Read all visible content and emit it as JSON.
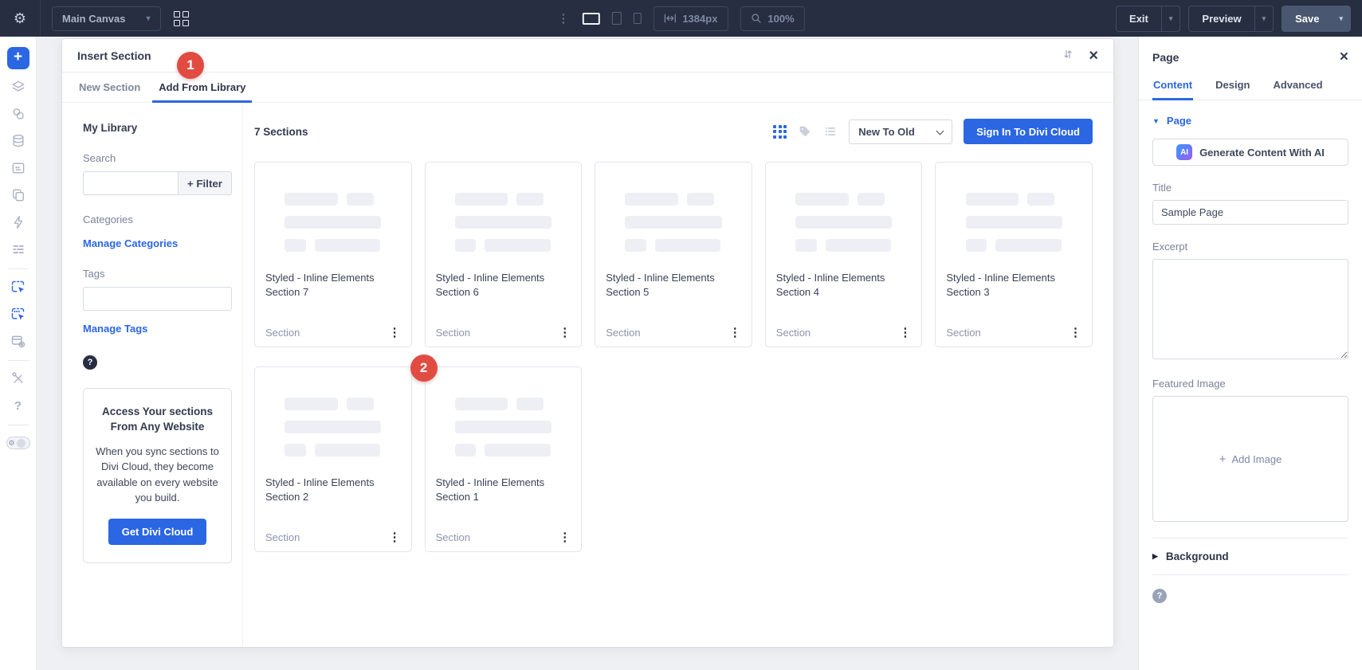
{
  "colors": {
    "accent": "#2b66e3",
    "badge_red": "#e14b42",
    "topbar_bg": "#272e42"
  },
  "icons": {
    "gear": "⚙",
    "kebab_vertical": "⋮",
    "close": "×",
    "chevron_down": "▾",
    "caret_down_filled": "▼",
    "caret_right_filled": "▶",
    "plus": "+",
    "question": "?"
  },
  "topbar": {
    "canvas_selector": "Main Canvas",
    "width_value": "1384px",
    "zoom_value": "100%",
    "exit_label": "Exit",
    "preview_label": "Preview",
    "save_label": "Save"
  },
  "badges": {
    "one": "1",
    "two": "2"
  },
  "modal": {
    "title": "Insert Section",
    "tabs": [
      {
        "label": "New Section",
        "active": false
      },
      {
        "label": "Add From Library",
        "active": true
      }
    ],
    "library": {
      "heading": "My Library",
      "search_label": "Search",
      "filter_button": "+ Filter",
      "categories_label": "Categories",
      "manage_categories_link": "Manage Categories",
      "tags_label": "Tags",
      "manage_tags_link": "Manage Tags",
      "help": "?",
      "promo": {
        "heading": "Access Your sections From Any Website",
        "body": "When you sync sections to Divi Cloud, they become available on every website you build.",
        "button": "Get Divi Cloud"
      }
    },
    "toolbar": {
      "count": "7 Sections",
      "sort_value": "New To Old",
      "signin_button": "Sign In To Divi Cloud"
    },
    "cards": [
      {
        "title": "Styled - Inline Elements Section 7",
        "type": "Section"
      },
      {
        "title": "Styled - Inline Elements Section 6",
        "type": "Section"
      },
      {
        "title": "Styled - Inline Elements Section 5",
        "type": "Section"
      },
      {
        "title": "Styled - Inline Elements Section 4",
        "type": "Section"
      },
      {
        "title": "Styled - Inline Elements Section 3",
        "type": "Section"
      },
      {
        "title": "Styled - Inline Elements Section 2",
        "type": "Section"
      },
      {
        "title": "Styled - Inline Elements Section 1",
        "type": "Section"
      }
    ]
  },
  "settings_panel": {
    "title": "Page",
    "tabs": [
      {
        "label": "Content",
        "active": true
      },
      {
        "label": "Design",
        "active": false
      },
      {
        "label": "Advanced",
        "active": false
      }
    ],
    "page_accordion": "Page",
    "ai_button": "Generate Content With AI",
    "ai_chip": "AI",
    "title_label": "Title",
    "title_value": "Sample Page",
    "excerpt_label": "Excerpt",
    "featured_label": "Featured Image",
    "add_image_label": "Add Image",
    "background_accordion": "Background",
    "help": "?"
  }
}
